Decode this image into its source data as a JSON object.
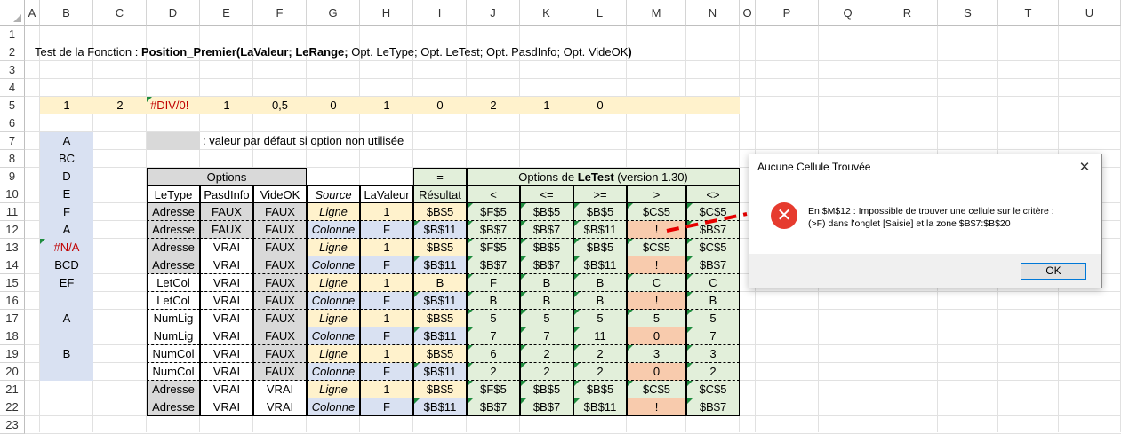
{
  "columns": [
    "A",
    "B",
    "C",
    "D",
    "E",
    "F",
    "G",
    "H",
    "I",
    "J",
    "K",
    "L",
    "M",
    "N",
    "O",
    "P",
    "Q",
    "R",
    "S",
    "T",
    "U"
  ],
  "rows": [
    "1",
    "2",
    "3",
    "4",
    "5",
    "6",
    "7",
    "8",
    "9",
    "10",
    "11",
    "12",
    "13",
    "14",
    "15",
    "16",
    "17",
    "18",
    "19",
    "20",
    "21",
    "22",
    "23"
  ],
  "title": {
    "label": "Test de la Fonction :",
    "func_bold": "Position_Premier(LaValeur; LeRange;",
    "func_rest": " Opt. LeType; Opt. LeTest; Opt. PasdInfo; Opt. VideOK",
    "func_close": ")"
  },
  "row5": [
    "1",
    "2",
    "#DIV/0!",
    "1",
    "0,5",
    "0",
    "1",
    "0",
    "2",
    "1",
    "0"
  ],
  "colB": [
    "A",
    "BC",
    "D",
    "E",
    "F",
    "A",
    "#N/A",
    "BCD",
    "EF",
    "",
    "A",
    "",
    "B"
  ],
  "legend": ": valeur par défaut si option non utilisée",
  "table": {
    "options_header": "Options",
    "eq_header": "=",
    "letest_header_pre": "Options de ",
    "letest_header_bold": "LeTest",
    "letest_header_post": " (version 1.30)",
    "headers": [
      "LeType",
      "PasdInfo",
      "VideOK",
      "Source",
      "LaValeur",
      "Résultat",
      "<",
      "<=",
      ">=",
      ">",
      "<>"
    ],
    "rows": [
      [
        "Adresse",
        "FAUX",
        "FAUX",
        "Ligne",
        "1",
        "$B$5",
        "$F$5",
        "$B$5",
        "$B$5",
        "$C$5",
        "$C$5"
      ],
      [
        "Adresse",
        "FAUX",
        "FAUX",
        "Colonne",
        "F",
        "$B$11",
        "$B$7",
        "$B$7",
        "$B$11",
        "!",
        "$B$7"
      ],
      [
        "Adresse",
        "VRAI",
        "FAUX",
        "Ligne",
        "1",
        "$B$5",
        "$F$5",
        "$B$5",
        "$B$5",
        "$C$5",
        "$C$5"
      ],
      [
        "Adresse",
        "VRAI",
        "FAUX",
        "Colonne",
        "F",
        "$B$11",
        "$B$7",
        "$B$7",
        "$B$11",
        "!",
        "$B$7"
      ],
      [
        "LetCol",
        "VRAI",
        "FAUX",
        "Ligne",
        "1",
        "B",
        "F",
        "B",
        "B",
        "C",
        "C"
      ],
      [
        "LetCol",
        "VRAI",
        "FAUX",
        "Colonne",
        "F",
        "$B$11",
        "B",
        "B",
        "B",
        "!",
        "B"
      ],
      [
        "NumLig",
        "VRAI",
        "FAUX",
        "Ligne",
        "1",
        "$B$5",
        "5",
        "5",
        "5",
        "5",
        "5"
      ],
      [
        "NumLig",
        "VRAI",
        "FAUX",
        "Colonne",
        "F",
        "$B$11",
        "7",
        "7",
        "11",
        "0",
        "7"
      ],
      [
        "NumCol",
        "VRAI",
        "FAUX",
        "Ligne",
        "1",
        "$B$5",
        "6",
        "2",
        "2",
        "3",
        "3"
      ],
      [
        "NumCol",
        "VRAI",
        "FAUX",
        "Colonne",
        "F",
        "$B$11",
        "2",
        "2",
        "2",
        "0",
        "2"
      ],
      [
        "Adresse",
        "VRAI",
        "VRAI",
        "Ligne",
        "1",
        "$B$5",
        "$F$5",
        "$B$5",
        "$B$5",
        "$C$5",
        "$C$5"
      ],
      [
        "Adresse",
        "VRAI",
        "VRAI",
        "Colonne",
        "F",
        "$B$11",
        "$B$7",
        "$B$7",
        "$B$11",
        "!",
        "$B$7"
      ]
    ]
  },
  "dialog": {
    "title": "Aucune Cellule Trouvée",
    "close": "✕",
    "icon": "error-icon",
    "message_line1": "En $M$12 : Impossible de trouver une cellule sur le critère :",
    "message_line2": "(>F) dans l'onglet [Saisie] et la zone $B$7:$B$20",
    "ok_label": "OK"
  },
  "colors": {
    "yellow": "#fff2cc",
    "blue": "#d9e1f2",
    "green": "#e2efda",
    "gray": "#d9d9d9",
    "salmon": "#f8cbad",
    "error_red": "#c00000",
    "arrow_red": "#e60000"
  }
}
